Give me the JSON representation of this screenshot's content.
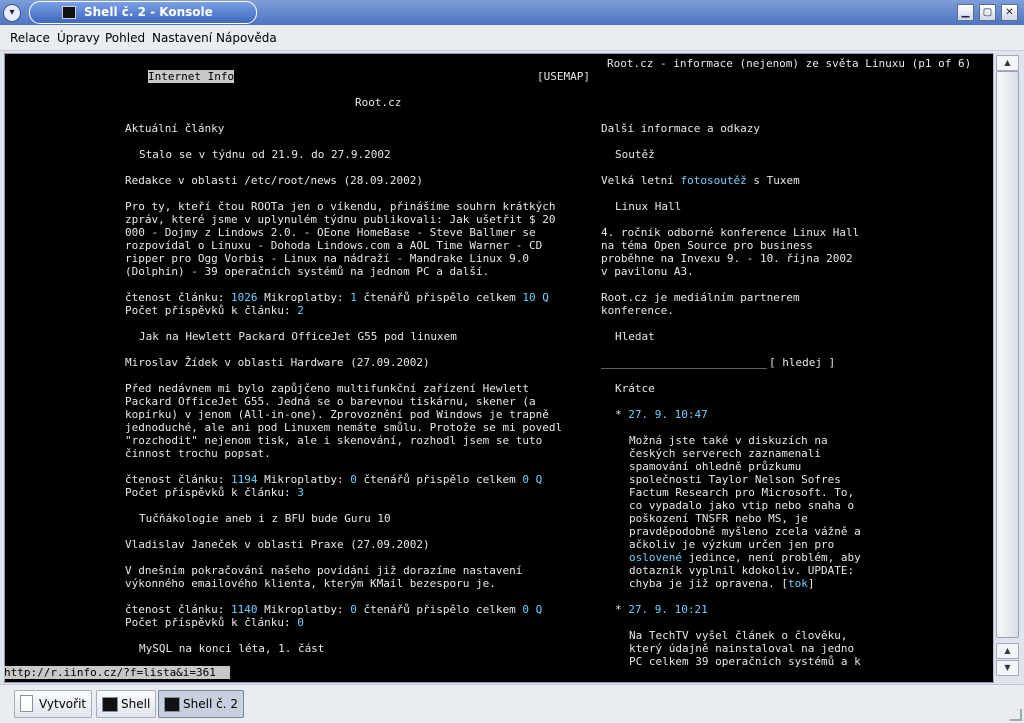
{
  "window": {
    "title": "Shell č. 2 - Konsole",
    "buttons": {
      "minimize": "▁",
      "restore": "▢",
      "close": "✕"
    }
  },
  "menubar": [
    "Relace",
    "Úpravy",
    "Pohled",
    "Nastavení",
    "Nápověda"
  ],
  "terminal": {
    "header_left": "Internet Info",
    "header_usemap": "[USEMAP]",
    "header_right": "Root.cz - informace (nejenom) ze světa Linuxu (p1 of 6)",
    "site": "Root.cz",
    "left_heading": "Aktuální články",
    "right_heading": "Další informace a odkazy",
    "articles": [
      {
        "title": "Stalo se v týdnu od 21.9. do 27.9.2002",
        "author": "Redakce",
        "section": "/etc/root/news",
        "date": "(28.09.2002)",
        "body": [
          "Pro ty, kteří čtou ROOTa jen o víkendu, přinášíme souhrn krátkých",
          "zpráv, které jsme v uplynulém týdnu publikovali: Jak ušetřit $ 20",
          "000 - Dojmy z Lindows 2.0. - OEone HomeBase - Steve Ballmer se",
          "rozpovídal o Linuxu - Dohoda Lindows.com a AOL Time Warner - CD",
          "ripper pro Ogg Vorbis - Linux na nádraží - Mandrake Linux 9.0",
          "(Dolphin) - 39 operačních systémů na jednom PC a další."
        ],
        "reads": "1026",
        "micropay": "1",
        "readers": "10 Q",
        "comments": "2"
      },
      {
        "title": "Jak na Hewlett Packard OfficeJet G55 pod linuxem",
        "author": "Miroslav Žídek",
        "section": "Hardware",
        "date": "(27.09.2002)",
        "body": [
          "Před nedávnem mi bylo zapůjčeno multifunkční zařízení Hewlett",
          "Packard OfficeJet G55. Jedná se o barevnou tiskárnu, skener (a",
          "kopírku) v jenom (All-in-one). Zprovoznění pod Windows je trapně",
          "jednoduché, ale ani pod Linuxem nemáte smůlu. Protože se mi povedl",
          "\"rozchodit\" nejenom tisk, ale i skenování, rozhodl jsem se tuto",
          "činnost trochu popsat."
        ],
        "reads": "1194",
        "micropay": "0",
        "readers": "0 Q",
        "comments": "3"
      },
      {
        "title": "Tučňákologie aneb i z BFU bude Guru 10",
        "author": "Vladislav Janeček",
        "section": "Praxe",
        "date": "(27.09.2002)",
        "body": [
          "V dnešním pokračování našeho povídání již dorazíme nastavení",
          "výkonného emailového klienta, kterým KMail bezesporu je."
        ],
        "reads": "1140",
        "micropay": "0",
        "readers": "0 Q",
        "comments": "0"
      }
    ],
    "next_article_title": "MySQL na konci léta, 1. část",
    "labels": {
      "by": "v oblasti",
      "reads": "čtenost článku:",
      "micropay": "Mikroplatby:",
      "readers": "čtenářů přispělo celkem",
      "comments": "Počet příspěvků k článku:"
    },
    "right": {
      "contest_heading": "Soutěž",
      "contest_line_pre": "Velká letní",
      "contest_link": "fotosoutěž",
      "contest_line_post": "s Tuxem",
      "hall_heading": "Linux Hall",
      "hall_body": [
        "4. ročník odborné konference Linux Hall",
        "na téma Open Source pro business",
        "proběhne na Invexu 9. - 10. října 2002",
        "v pavilonu A3."
      ],
      "partner_body": [
        "Root.cz je mediálním partnerem",
        "konference."
      ],
      "search_heading": "Hledat",
      "search_field": "_________________________",
      "search_button": "[ hledej ]",
      "news_heading": "Krátce",
      "news": [
        {
          "time": "27. 9. 10:47",
          "body": [
            "Možná jste také v diskuzích na",
            "českých serverech zaznamenali",
            "spamování ohledně průzkumu",
            "společnosti Taylor Nelson Sofres",
            "Factum Research pro Microsoft. To,",
            "co vypadalo jako vtip nebo snaha o",
            "poškození TNSFR nebo MS, je",
            "pravděpodobně myšleno zcela vážně a",
            "ačkoliv je výzkum určen jen pro"
          ],
          "link_line_pre": "",
          "link": "oslovené",
          "link_line_post": " jedince, není problém, aby",
          "body2": [
            "dotazník vyplnil kdokoliv. UPDATE:"
          ],
          "tail_pre": "chyba je již opravena. [",
          "tail_link": "tok",
          "tail_post": "]"
        },
        {
          "time": "27. 9. 10:21",
          "body": [
            "Na TechTV vyšel článek o člověku,",
            "který údajně nainstaloval na jedno",
            "PC celkem 39 operačních systémů a k"
          ]
        }
      ]
    },
    "status_url": "http://r.iinfo.cz/?f=lista&i=361"
  },
  "taskbar": {
    "new_button": "Vytvořit",
    "tasks": [
      "Shell",
      "Shell č. 2"
    ]
  }
}
